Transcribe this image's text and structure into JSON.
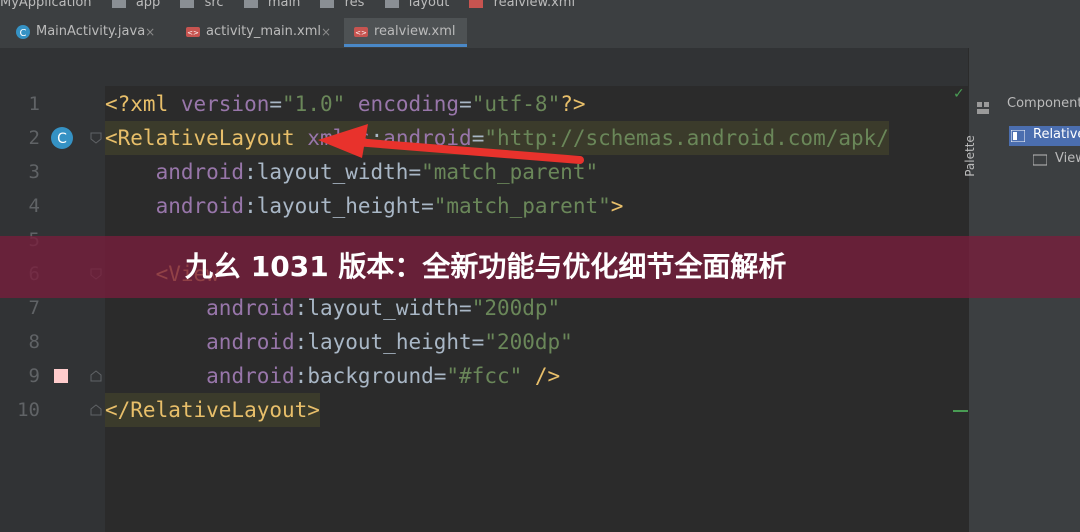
{
  "breadcrumb": [
    "MyApplication",
    "app",
    "src",
    "main",
    "res",
    "layout",
    "realview.xml"
  ],
  "tabs": [
    {
      "label": "MainActivity.java",
      "icon": "java-class-icon"
    },
    {
      "label": "activity_main.xml",
      "icon": "xml-layout-icon"
    },
    {
      "label": "realview.xml",
      "icon": "xml-layout-icon",
      "active": true
    }
  ],
  "editor": {
    "lines": [
      {
        "num": "1",
        "tokens": [
          [
            "tag",
            "<?xml "
          ],
          [
            "attr",
            "version"
          ],
          [
            "pl",
            "="
          ],
          [
            "val",
            "\"1.0\""
          ],
          [
            "pl",
            " "
          ],
          [
            "attr",
            "encoding"
          ],
          [
            "pl",
            "="
          ],
          [
            "val",
            "\"utf-8\""
          ],
          [
            "tag",
            "?>"
          ]
        ]
      },
      {
        "num": "2",
        "tokens": [
          [
            "tag",
            "<RelativeLayout "
          ],
          [
            "attr",
            "xmlns"
          ],
          [
            "pl",
            ":"
          ],
          [
            "attr",
            "android"
          ],
          [
            "pl",
            "="
          ],
          [
            "val",
            "\"http://schemas.android.com/apk/"
          ]
        ]
      },
      {
        "num": "3",
        "tokens": [
          [
            "pl",
            "    "
          ],
          [
            "attr",
            "android"
          ],
          [
            "pl",
            ":layout_width="
          ],
          [
            "val",
            "\"match_parent\""
          ]
        ]
      },
      {
        "num": "4",
        "tokens": [
          [
            "pl",
            "    "
          ],
          [
            "attr",
            "android"
          ],
          [
            "pl",
            ":layout_height="
          ],
          [
            "val",
            "\"match_parent\""
          ],
          [
            "tag",
            ">"
          ]
        ]
      },
      {
        "num": "5",
        "tokens": []
      },
      {
        "num": "6",
        "tokens": [
          [
            "pl",
            "    "
          ],
          [
            "tag",
            "<View"
          ]
        ]
      },
      {
        "num": "7",
        "tokens": [
          [
            "pl",
            "        "
          ],
          [
            "attr",
            "android"
          ],
          [
            "pl",
            ":layout_width="
          ],
          [
            "val",
            "\"200dp\""
          ]
        ]
      },
      {
        "num": "8",
        "tokens": [
          [
            "pl",
            "        "
          ],
          [
            "attr",
            "android"
          ],
          [
            "pl",
            ":layout_height="
          ],
          [
            "val",
            "\"200dp\""
          ]
        ]
      },
      {
        "num": "9",
        "tokens": [
          [
            "pl",
            "        "
          ],
          [
            "attr",
            "android"
          ],
          [
            "pl",
            ":background="
          ],
          [
            "val",
            "\"#fcc\""
          ],
          [
            "pl",
            " "
          ],
          [
            "tag",
            "/>"
          ]
        ]
      },
      {
        "num": "10",
        "tokens": [
          [
            "tag",
            "</RelativeLayout>"
          ]
        ]
      }
    ]
  },
  "right_panel": {
    "palette_label": "Palette",
    "component_tree_label": "Component",
    "tree_items": [
      "Relative",
      "View"
    ]
  },
  "banner": {
    "text": "九幺 1031 版本：全新功能与优化细节全面解析"
  },
  "colors": {
    "swatch_fcc": "#ffcccc",
    "arrow": "#e8322c",
    "banner_bg": "#781e3c"
  }
}
